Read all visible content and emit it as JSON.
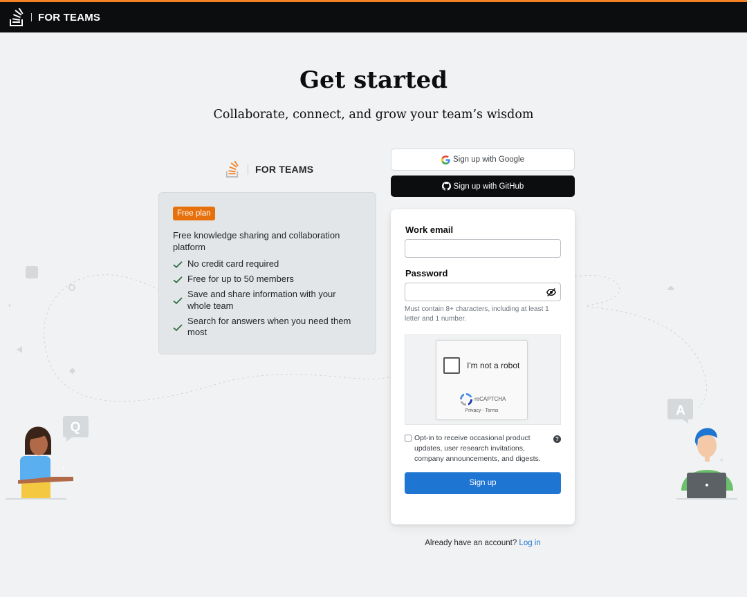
{
  "header": {
    "brand": "FOR TEAMS",
    "accent_color": "#f48225",
    "logo_icon": "stack-overflow-logo"
  },
  "hero": {
    "title": "Get started",
    "subtitle": "Collaborate, connect, and grow your team’s wisdom"
  },
  "plan": {
    "brand": "FOR TEAMS",
    "badge": "Free plan",
    "description": "Free knowledge sharing and collaboration platform",
    "features": [
      "No credit card required",
      "Free for up to 50 members",
      "Save and share information with your whole team",
      "Search for answers when you need them most"
    ]
  },
  "oauth": {
    "google_label": "Sign up with Google",
    "github_label": "Sign up with GitHub"
  },
  "form": {
    "email_label": "Work email",
    "email_value": "",
    "password_label": "Password",
    "password_value": "",
    "password_hint": "Must contain 8+ characters, including at least 1 letter and 1 number.",
    "captcha": {
      "label": "I'm not a robot",
      "brand": "reCAPTCHA",
      "links": "Privacy - Terms"
    },
    "optin_label": "Opt-in to receive occasional product updates, user research invitations, company announcements, and digests.",
    "submit_label": "Sign up"
  },
  "footer": {
    "prompt": "Already have an account?",
    "login_label": "Log in"
  },
  "illustration": {
    "left_bubble_letter": "Q",
    "right_bubble_letter": "A"
  }
}
